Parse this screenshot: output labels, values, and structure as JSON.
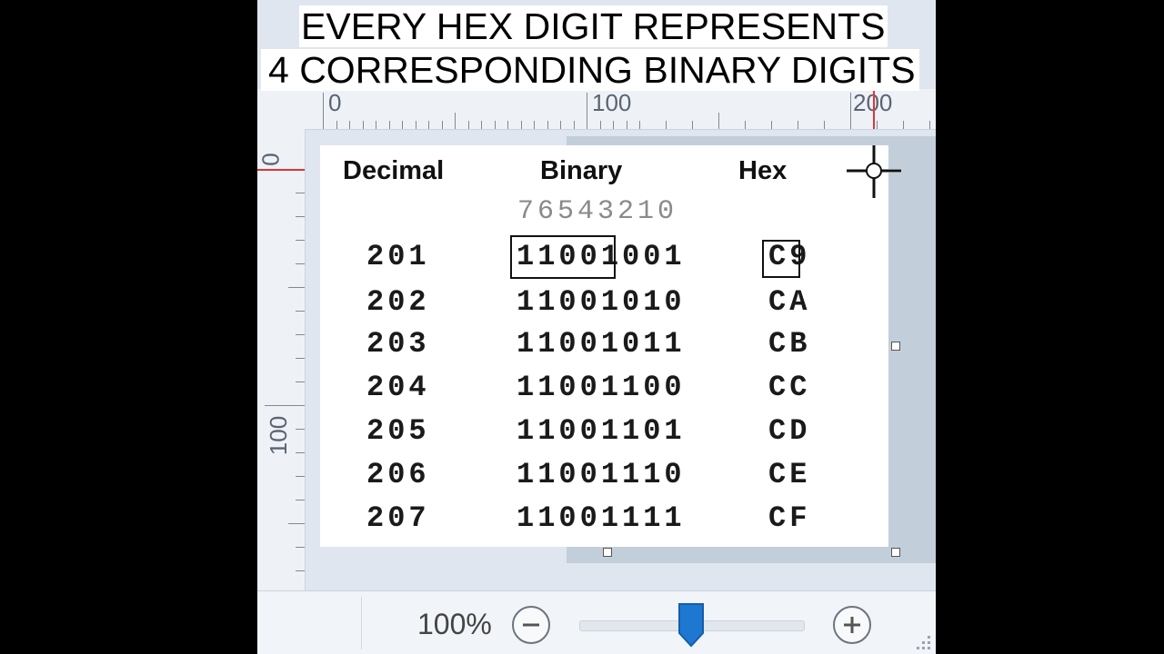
{
  "caption": {
    "line1": "EVERY HEX DIGIT REPRESENTS",
    "line2": "4 CORRESPONDING BINARY DIGITS"
  },
  "ruler_top": {
    "labels": [
      "0",
      "100",
      "200"
    ]
  },
  "ruler_left": {
    "labels": [
      "0",
      "100"
    ]
  },
  "table": {
    "headers": {
      "decimal": "Decimal",
      "binary": "Binary",
      "hex": "Hex"
    },
    "bit_indices": "76543210",
    "rows": [
      {
        "decimal": "201",
        "binary": "11001001",
        "hex": "C9"
      },
      {
        "decimal": "202",
        "binary": "11001010",
        "hex": "CA"
      },
      {
        "decimal": "203",
        "binary": "11001011",
        "hex": "CB"
      },
      {
        "decimal": "204",
        "binary": "11001100",
        "hex": "CC"
      },
      {
        "decimal": "205",
        "binary": "11001101",
        "hex": "CD"
      },
      {
        "decimal": "206",
        "binary": "11001110",
        "hex": "CE"
      },
      {
        "decimal": "207",
        "binary": "11001111",
        "hex": "CF"
      }
    ]
  },
  "statusbar": {
    "zoom_label": "100%",
    "zoom_level_percent": 100,
    "zoom_out_icon": "minus-circle-icon",
    "zoom_in_icon": "plus-circle-icon"
  },
  "colors": {
    "accent": "#1e78d2",
    "ruler_marker": "#e0333b",
    "caption_bg": "#ffffff"
  }
}
